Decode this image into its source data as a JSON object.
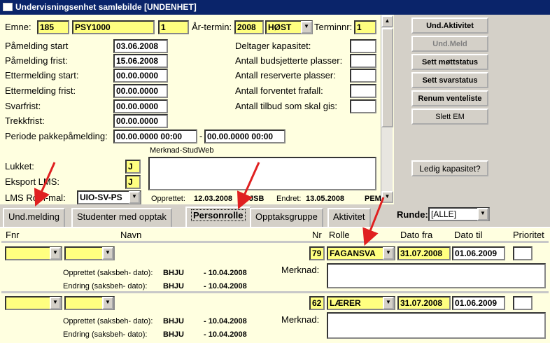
{
  "window": {
    "title": "Undervisningsenhet samlebilde [UNDENHET]"
  },
  "header": {
    "emne_label": "Emne:",
    "emne_inst": "185",
    "emne_kode": "PSY1000",
    "emne_versjon": "1",
    "arstermin_label": "År-termin:",
    "ar": "2008",
    "termin": "HØST",
    "terminnr_label": "Terminnr:",
    "terminnr": "1"
  },
  "dates": {
    "pamelding_start_label": "Påmelding start",
    "pamelding_start": "03.06.2008",
    "pamelding_frist_label": "Påmelding frist:",
    "pamelding_frist": "15.06.2008",
    "ettermelding_start_label": "Ettermelding start:",
    "ettermelding_start": "00.00.0000",
    "ettermelding_frist_label": "Ettermelding frist:",
    "ettermelding_frist": "00.00.0000",
    "svarfrist_label": "Svarfrist:",
    "svarfrist": "00.00.0000",
    "trekkfrist_label": "Trekkfrist:",
    "trekkfrist": "00.00.0000",
    "periode_label": "Periode pakkepåmelding:",
    "periode_fra": "00.00.0000 00:00",
    "periode_sep": "-",
    "periode_til": "00.00.0000 00:00"
  },
  "capacity": {
    "deltager_label": "Deltager kapasitet:",
    "budsjett_label": "Antall budsjetterte plasser:",
    "reserverte_label": "Antall reserverte plasser:",
    "frafall_label": "Antall forventet frafall:",
    "tilbud_label": "Antall tilbud som skal gis:"
  },
  "flags": {
    "merknad_label": "Merknad-StudWeb",
    "lukket_label": "Lukket:",
    "lukket": "J",
    "eksport_label": "Eksport LMS:",
    "eksport": "J",
    "lmsmal_label": "LMS Rom-mal:",
    "lmsmal": "UIO-SV-PS",
    "opprettet_label": "Opprettet:",
    "opprettet_dato": "12.03.2008",
    "opprettet_av": "JSB",
    "endret_label": "Endret:",
    "endret_dato": "13.05.2008",
    "endret_av": "PEM"
  },
  "buttons": {
    "und_aktivitet": "Und.Aktivitet",
    "und_meld": "Und.Meld",
    "sett_mottstatus": "Sett møttstatus",
    "sett_svarstatus": "Sett svarstatus",
    "renum_venteliste": "Renum venteliste",
    "slett_em": "Slett EM",
    "ledig_kapasitet": "Ledig kapasitet?"
  },
  "tabs": [
    {
      "label": "Und.melding"
    },
    {
      "label": "Studenter med opptak"
    },
    {
      "label": "Personrolle"
    },
    {
      "label": "Opptaksgruppe"
    },
    {
      "label": "Aktivitet"
    }
  ],
  "runde": {
    "label": "Runde:",
    "value": "[ALLE]"
  },
  "columns": {
    "fnr": "Fnr",
    "navn": "Navn",
    "nr": "Nr",
    "rolle": "Rolle",
    "dato_fra": "Dato  fra",
    "dato_til": "Dato  til",
    "prioritet": "Prioritet"
  },
  "rows": [
    {
      "nr": "79",
      "rolle": "FAGANSVA",
      "dato_fra": "31.07.2008",
      "dato_til": "01.06.2009",
      "opprettet_label": "Opprettet (saksbeh- dato):",
      "opprettet_av": "BHJU",
      "opprettet_dato": "- 10.04.2008",
      "endring_label": "Endring (saksbeh- dato):",
      "endring_av": "BHJU",
      "endring_dato": "- 10.04.2008",
      "merknad_label": "Merknad:"
    },
    {
      "nr": "62",
      "rolle": "LÆRER",
      "dato_fra": "31.07.2008",
      "dato_til": "01.06.2009",
      "opprettet_label": "Opprettet (saksbeh- dato):",
      "opprettet_av": "BHJU",
      "opprettet_dato": "- 10.04.2008",
      "endring_label": "Endring (saksbeh- dato):",
      "endring_av": "BHJU",
      "endring_dato": "- 10.04.2008",
      "merknad_label": "Merknad:"
    }
  ],
  "colors": {
    "title_bg": "#0a246a",
    "panel_bg": "#ffffe0",
    "field_yellow": "#ffff80",
    "annotation_red": "#e02020"
  }
}
